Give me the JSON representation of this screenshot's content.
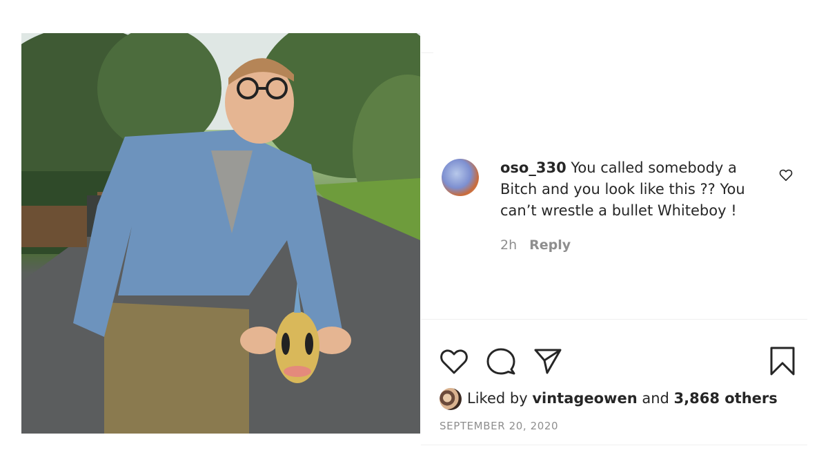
{
  "post": {
    "photo_alt": "Man in denim jacket holding a Pokémon in a park"
  },
  "comment": {
    "username": "oso_330",
    "text": " You called somebody a Bitch and you look like this ?? You can’t wrestle a bullet Whiteboy !",
    "time": "2h",
    "reply_label": "Reply"
  },
  "actions": {
    "like_icon": "heart-icon",
    "comment_icon": "speech-bubble-icon",
    "share_icon": "paper-plane-icon",
    "save_icon": "bookmark-icon"
  },
  "likes": {
    "prefix": "Liked by ",
    "user": "vintageowen",
    "middle": " and ",
    "count": "3,868 others"
  },
  "date": "SEPTEMBER 20, 2020",
  "colors": {
    "text": "#262626",
    "muted": "#8e8e8e",
    "divider": "#efefef"
  }
}
